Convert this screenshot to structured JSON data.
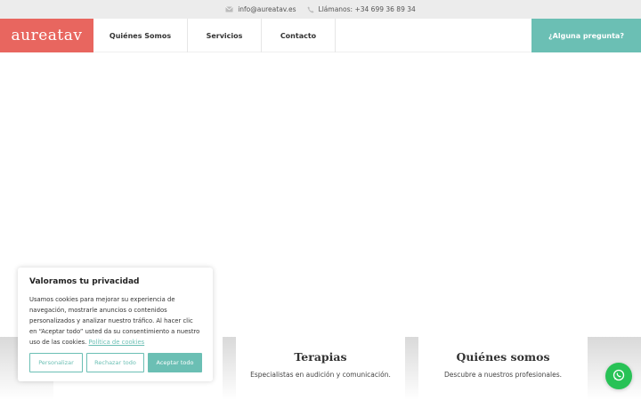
{
  "topbar": {
    "email": "info@aureatav.es",
    "phone_text": "Llámanos: +34 699 36 89 34",
    "email_icon": "envelope-icon",
    "phone_icon": "phone-icon"
  },
  "nav": {
    "logo": "aureatav",
    "items": [
      {
        "label": "Quiénes Somos"
      },
      {
        "label": "Servicios"
      },
      {
        "label": "Contacto"
      }
    ],
    "cta": "¿Alguna pregunta?"
  },
  "cards": [
    {
      "title": "",
      "text": ""
    },
    {
      "title": "Terapias",
      "text": "Especialistas en audición y comunicación."
    },
    {
      "title": "Quiénes somos",
      "text": "Descubre a nuestros profesionales."
    }
  ],
  "cookie": {
    "title": "Valoramos tu privacidad",
    "body": "Usamos cookies para mejorar su experiencia de navegación, mostrarle anuncios o contenidos personalizados y analizar nuestro tráfico. Al hacer clic en “Aceptar todo” usted da su consentimiento a nuestro uso de las cookies.",
    "link": "Política de cookies",
    "buttons": {
      "customize": "Personalizar",
      "reject": "Rechazar todo",
      "accept": "Aceptar todo"
    }
  },
  "colors": {
    "brand": "#e8665f",
    "accent": "#6bbfb4",
    "whatsapp": "#28c256"
  },
  "whatsapp_icon": "whatsapp-icon"
}
